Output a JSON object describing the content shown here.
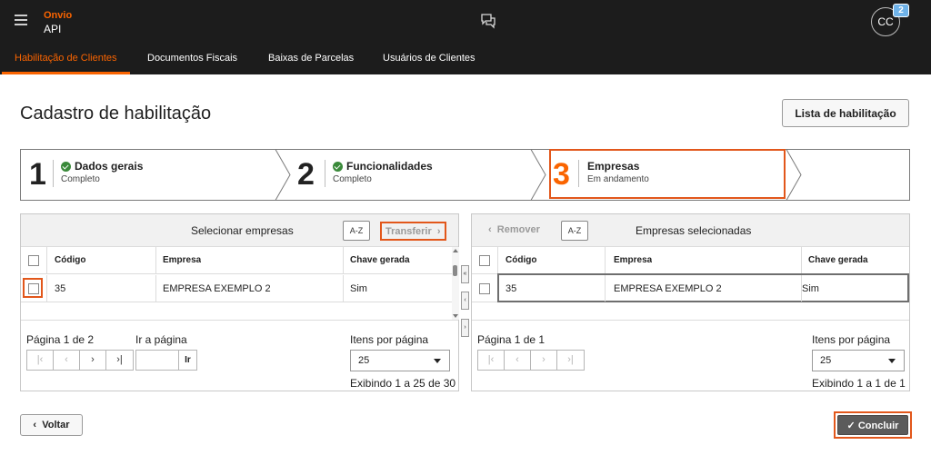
{
  "header": {
    "brand": "Onvio",
    "product": "API",
    "avatar_initials": "CC",
    "notification_count": "2",
    "icons": {
      "menu": "hamburger-menu-icon",
      "chat": "chat-bubbles-icon"
    }
  },
  "tabs": [
    {
      "label": "Habilitação de Clientes",
      "active": true
    },
    {
      "label": "Documentos Fiscais",
      "active": false
    },
    {
      "label": "Baixas de Parcelas",
      "active": false
    },
    {
      "label": "Usuários de Clientes",
      "active": false
    }
  ],
  "page": {
    "title": "Cadastro de habilitação",
    "list_button": "Lista de habilitação"
  },
  "steps": [
    {
      "number": "1",
      "title": "Dados gerais",
      "status": "Completo",
      "completed": true
    },
    {
      "number": "2",
      "title": "Funcionalidades",
      "status": "Completo",
      "completed": true
    },
    {
      "number": "3",
      "title": "Empresas",
      "status": "Em andamento",
      "completed": false,
      "current": true
    }
  ],
  "left_panel": {
    "title": "Selecionar empresas",
    "filter_icon": "A-Z",
    "action": "Transferir",
    "columns": [
      "Código",
      "Empresa",
      "Chave gerada"
    ],
    "rows": [
      {
        "codigo": "35",
        "empresa": "EMPRESA EXEMPLO 2",
        "chave": "Sim",
        "checked": false
      }
    ],
    "pager": {
      "page_info": "Página 1 de 2",
      "goto_label": "Ir a página",
      "goto_button": "Ir",
      "goto_value": "",
      "items_label": "Itens por página",
      "items_value": "25",
      "showing": "Exibindo 1 a 25 de 30"
    }
  },
  "right_panel": {
    "title": "Empresas selecionadas",
    "filter_icon": "A-Z",
    "action": "Remover",
    "columns": [
      "Código",
      "Empresa",
      "Chave gerada"
    ],
    "rows": [
      {
        "codigo": "35",
        "empresa": "EMPRESA EXEMPLO 2",
        "chave": "Sim",
        "checked": false
      }
    ],
    "pager": {
      "page_info": "Página 1 de 1",
      "items_label": "Itens por página",
      "items_value": "25",
      "showing": "Exibindo 1 a 1 de 1"
    }
  },
  "footer": {
    "back": "Voltar",
    "conclude": "Concluir"
  },
  "colors": {
    "accent": "#fa6400",
    "highlight": "#e2571b",
    "topbar": "#1c1c1c",
    "success": "#3a8a3a"
  }
}
